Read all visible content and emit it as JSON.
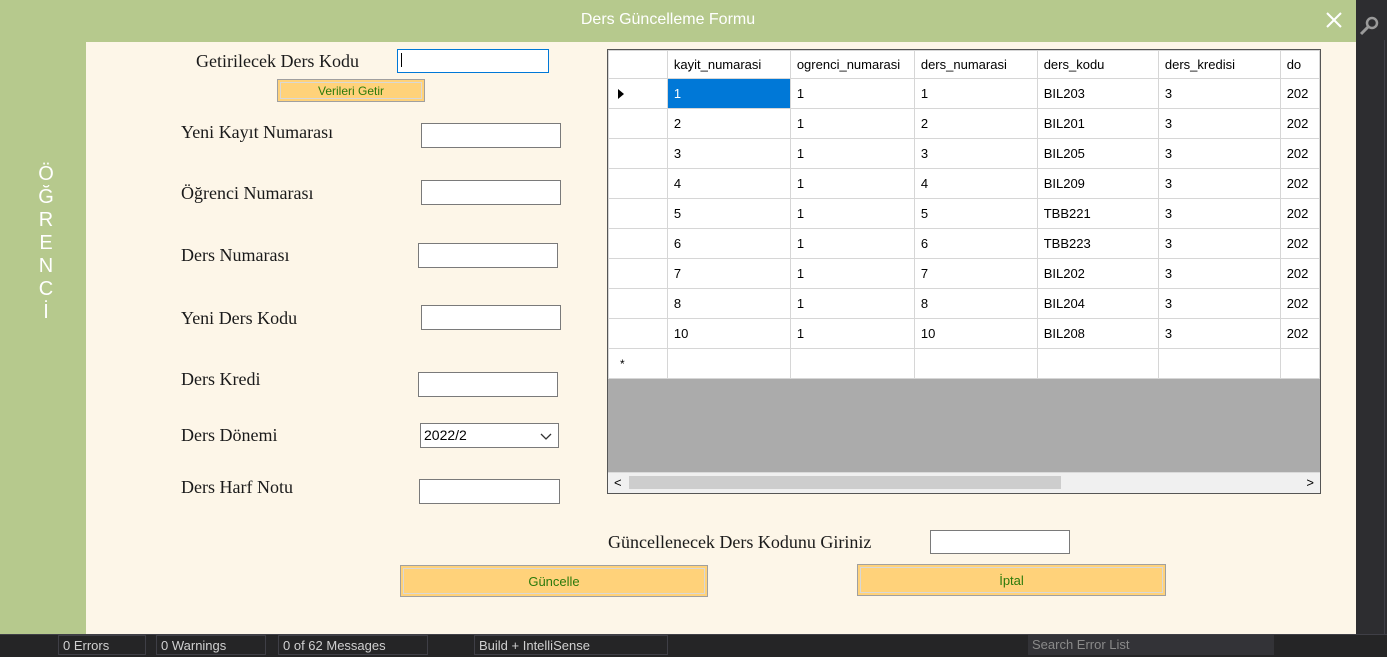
{
  "window": {
    "title": "Ders Güncelleme Formu"
  },
  "side_text": [
    "Ö",
    "Ğ",
    "R",
    "E",
    "N",
    "C",
    "İ"
  ],
  "form": {
    "fetch_label": "Getirilecek Ders Kodu",
    "fetch_value": "",
    "fetch_button": "Verileri Getir",
    "new_record_label": "Yeni Kayıt Numarası",
    "student_label": "Öğrenci Numarası",
    "course_no_label": "Ders Numarası",
    "new_course_code_label": "Yeni Ders Kodu",
    "credit_label": "Ders Kredi",
    "term_label": "Ders Dönemi",
    "term_value": "2022/2",
    "grade_label": "Ders Harf Notu",
    "update_code_label": "Güncellenecek Ders Kodunu Giriniz",
    "update_button": "Güncelle",
    "cancel_button": "İptal"
  },
  "grid": {
    "columns": [
      "kayit_numarasi",
      "ogrenci_numarasi",
      "ders_numarasi",
      "ders_kodu",
      "ders_kredisi",
      "do"
    ],
    "rows": [
      [
        "1",
        "1",
        "1",
        "BIL203",
        "3",
        "202"
      ],
      [
        "2",
        "1",
        "2",
        "BIL201",
        "3",
        "202"
      ],
      [
        "3",
        "1",
        "3",
        "BIL205",
        "3",
        "202"
      ],
      [
        "4",
        "1",
        "4",
        "BIL209",
        "3",
        "202"
      ],
      [
        "5",
        "1",
        "5",
        "TBB221",
        "3",
        "202"
      ],
      [
        "6",
        "1",
        "6",
        "TBB223",
        "3",
        "202"
      ],
      [
        "7",
        "1",
        "7",
        "BIL202",
        "3",
        "202"
      ],
      [
        "8",
        "1",
        "8",
        "BIL204",
        "3",
        "202"
      ],
      [
        "10",
        "1",
        "10",
        "BIL208",
        "3",
        "202"
      ]
    ],
    "new_row_marker": "*"
  },
  "ide": {
    "errors": "0 Errors",
    "warnings": "0 Warnings",
    "messages": "0 of 62 Messages",
    "build_filter": "Build + IntelliSense",
    "search_placeholder": "Search Error List"
  }
}
